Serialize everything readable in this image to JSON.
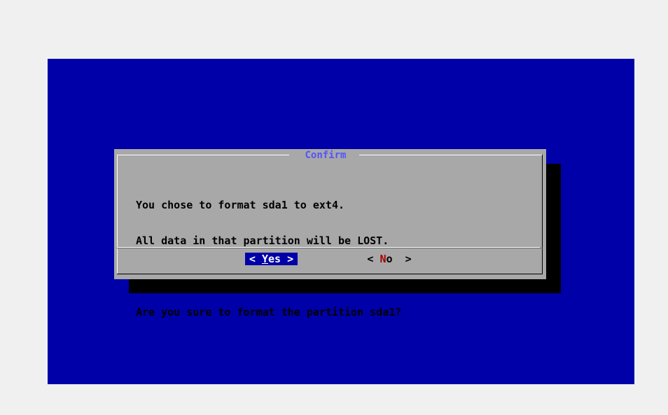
{
  "dialog": {
    "title": "Confirm",
    "lines": [
      "You chose to format sda1 to ext4.",
      "All data in that partition will be LOST.",
      "Are you sure to format the partition sda1?"
    ]
  },
  "buttons": {
    "yes": {
      "left": "<",
      "hot": "Y",
      "rest": "es",
      "right": ">",
      "selected": true
    },
    "no": {
      "left": "<",
      "hot": "N",
      "rest": "o",
      "right": ">",
      "selected": false
    }
  },
  "colors": {
    "screen_bg": "#0000a8",
    "dialog_bg": "#a8a8a8",
    "title_fg": "#5454fc",
    "selected_btn_bg": "#0000a8",
    "hotkey_no": "#a80000"
  }
}
